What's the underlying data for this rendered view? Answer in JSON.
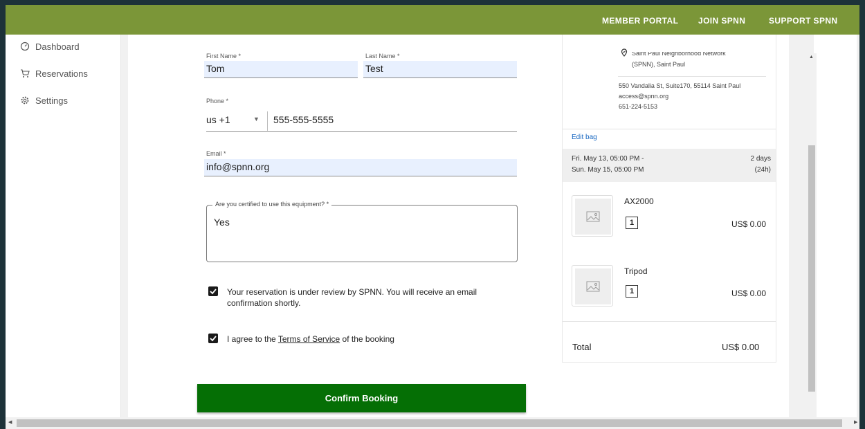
{
  "nav": {
    "links": [
      "MEMBER PORTAL",
      "JOIN SPNN",
      "SUPPORT SPNN"
    ]
  },
  "sidebar": {
    "items": [
      {
        "label": "Dashboard",
        "icon": "dashboard-icon"
      },
      {
        "label": "Reservations",
        "icon": "cart-icon"
      },
      {
        "label": "Settings",
        "icon": "gear-icon"
      }
    ]
  },
  "form": {
    "first_name": {
      "label": "First Name *",
      "value": "Tom"
    },
    "last_name": {
      "label": "Last Name *",
      "value": "Test"
    },
    "phone": {
      "label": "Phone *",
      "country": "us +1",
      "value": "555-555-5555"
    },
    "email": {
      "label": "Email *",
      "value": "info@spnn.org"
    },
    "certified": {
      "label": "Are you certified to use this equipment? *",
      "value": "Yes"
    },
    "review_notice": "Your reservation is under review by SPNN. You will receive an email confirmation shortly.",
    "agree_prefix": "I agree to the ",
    "agree_link": "Terms of Service",
    "agree_suffix": " of the booking",
    "confirm_label": "Confirm Booking"
  },
  "summary": {
    "location_name_line1": "Saint Paul Neighborhood Network",
    "location_name_line2": "(SPNN), Saint Paul",
    "address": "550 Vandalia St, Suite170, 55114 Saint Paul",
    "email": "access@spnn.org",
    "phone": "651-224-5153",
    "edit_bag": "Edit bag",
    "start": "Fri. May 13, 05:00 PM -",
    "end": "Sun. May 15, 05:00 PM",
    "duration_line1": "2 days",
    "duration_line2": "(24h)",
    "items": [
      {
        "name": "AX2000",
        "qty": "1",
        "price": "US$ 0.00"
      },
      {
        "name": "Tripod",
        "qty": "1",
        "price": "US$ 0.00"
      }
    ],
    "total_label": "Total",
    "total_value": "US$ 0.00"
  },
  "colors": {
    "topbar": "#7b9638",
    "confirm": "#056f05",
    "link_blue": "#1565c0"
  }
}
